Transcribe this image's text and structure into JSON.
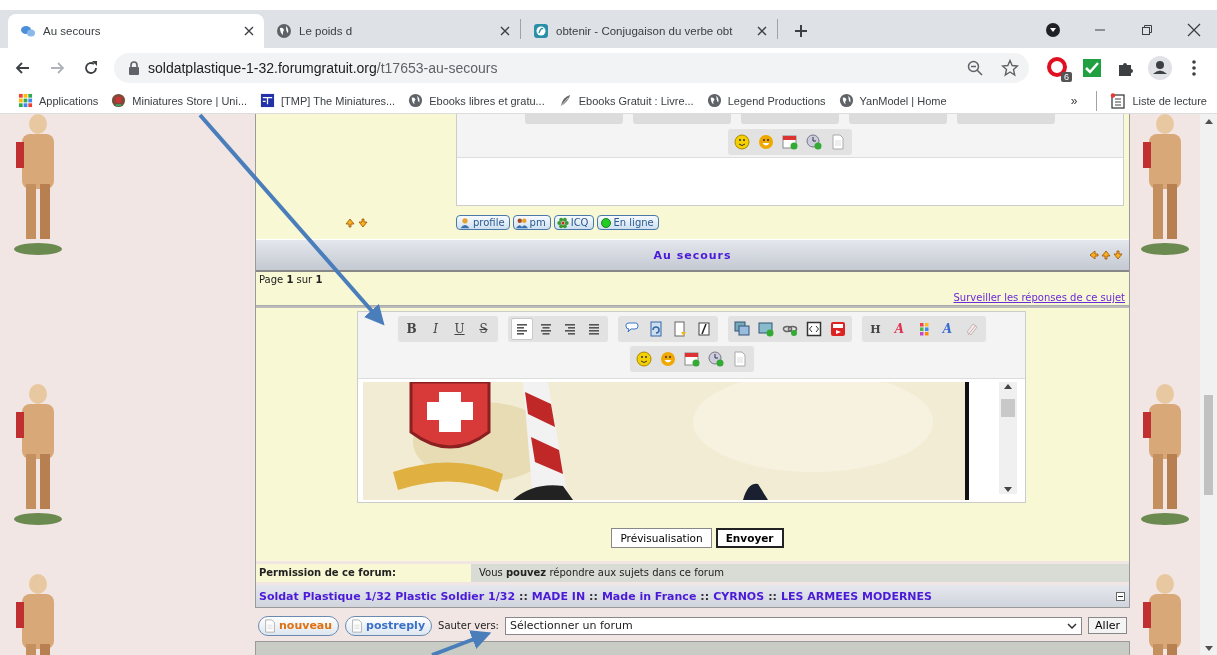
{
  "browser": {
    "tabs": [
      {
        "title": "Au secours",
        "selected": true
      },
      {
        "title": "Le poids d",
        "selected": false
      },
      {
        "title": "obtenir - Conjugaison du verbe obt",
        "selected": false
      }
    ],
    "url": {
      "host": "soldatplastique-1-32.forumgratuit.org",
      "path": "/t17653-au-secours"
    },
    "extension_badge": "6",
    "bookmarks": [
      {
        "label": "Applications"
      },
      {
        "label": "Miniatures Store | Uni..."
      },
      {
        "label": "[TMP] The Miniatures..."
      },
      {
        "label": "Ebooks libres et gratu..."
      },
      {
        "label": "Ebooks Gratuit : Livre..."
      },
      {
        "label": "Legend Productions"
      },
      {
        "label": "YanModel | Home"
      }
    ],
    "bookmarks_more": "»",
    "reading_list": "Liste de lecture"
  },
  "forum": {
    "top_post": {
      "smilies": [
        {
          "kind": "smiley"
        },
        {
          "kind": "grin"
        },
        {
          "kind": "calendar"
        },
        {
          "kind": "clock"
        },
        {
          "kind": "page"
        }
      ],
      "profile_buttons": [
        {
          "label": "profile"
        },
        {
          "label": "pm"
        },
        {
          "label": "ICQ"
        },
        {
          "label": "En ligne"
        }
      ]
    },
    "topic_title": "Au secours",
    "pagination": "Page **1** sur **1**",
    "watch_link": "Surveiller les réponses de ce sujet",
    "editor": {
      "toolbar_rows": [
        [
          [
            {
              "kind": "bold",
              "label": "B",
              "selected": false
            },
            {
              "kind": "italic",
              "label": "I",
              "selected": false
            },
            {
              "kind": "underline",
              "label": "U",
              "selected": false
            },
            {
              "kind": "strike",
              "label": "S",
              "selected": false
            }
          ],
          [
            {
              "kind": "align-left",
              "selected": true
            },
            {
              "kind": "align-center",
              "selected": false
            },
            {
              "kind": "align-right",
              "selected": false
            },
            {
              "kind": "justify",
              "selected": false
            }
          ],
          [
            {
              "kind": "bubble",
              "selected": false
            },
            {
              "kind": "doc-refresh",
              "selected": false
            },
            {
              "kind": "doc-note",
              "selected": false
            },
            {
              "kind": "doc-edit",
              "selected": false
            }
          ],
          [
            {
              "kind": "images",
              "selected": false
            },
            {
              "kind": "image-add",
              "selected": false
            },
            {
              "kind": "link",
              "selected": false
            },
            {
              "kind": "code",
              "selected": false
            },
            {
              "kind": "video",
              "selected": false
            }
          ],
          [
            {
              "kind": "heading",
              "label": "H",
              "selected": false
            },
            {
              "kind": "font-size",
              "label": "A",
              "selected": false
            },
            {
              "kind": "colors",
              "selected": false
            },
            {
              "kind": "font-face",
              "label": "A",
              "selected": false
            },
            {
              "kind": "eraser",
              "selected": false
            }
          ]
        ],
        [
          [
            {
              "kind": "smiley",
              "selected": false
            },
            {
              "kind": "grin",
              "selected": false
            },
            {
              "kind": "calendar",
              "selected": false
            },
            {
              "kind": "clock",
              "selected": false
            },
            {
              "kind": "page",
              "selected": false
            }
          ]
        ]
      ],
      "content": {
        "kind": "picture"
      }
    },
    "actions": [
      {
        "label": "Prévisualisation",
        "default": false
      },
      {
        "label": "Envoyer",
        "default": true
      }
    ],
    "permission": {
      "label": "Permission de ce forum:",
      "text": "Vous **pouvez** répondre aux sujets dans ce forum"
    },
    "breadcrumbs": [
      {
        "kind": "link",
        "text": "Soldat Plastique 1/32 Plastic Soldier 1/32"
      },
      {
        "kind": "separator",
        "text": "::"
      },
      {
        "kind": "link",
        "text": "MADE IN"
      },
      {
        "kind": "separator",
        "text": "::"
      },
      {
        "kind": "link",
        "text": "Made in France"
      },
      {
        "kind": "separator",
        "text": "::"
      },
      {
        "kind": "link",
        "text": "CYRNOS"
      },
      {
        "kind": "separator",
        "text": "::"
      },
      {
        "kind": "link",
        "text": "LES ARMEES MODERNES"
      }
    ],
    "jump": {
      "buttons": [
        {
          "label": "nouveau"
        },
        {
          "label": "postreply"
        }
      ],
      "label": "Sauter vers:",
      "select": "Sélectionner un forum",
      "go": "Aller"
    }
  }
}
